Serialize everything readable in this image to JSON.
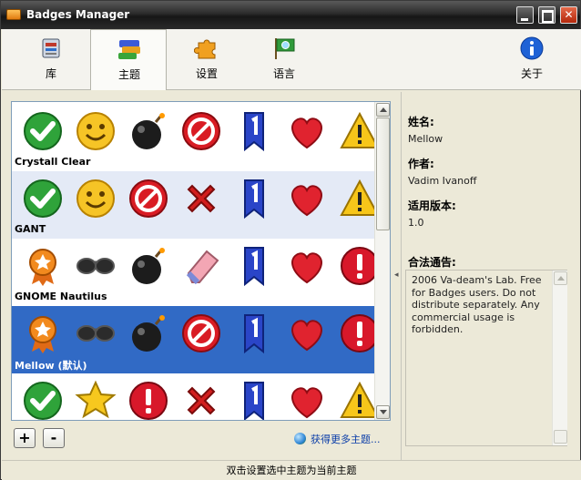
{
  "window": {
    "title": "Badges Manager",
    "controls": [
      "minimize",
      "maximize",
      "close"
    ]
  },
  "toolbar": {
    "items": [
      {
        "label": "库",
        "icon": "library-icon"
      },
      {
        "label": "主题",
        "icon": "themes-icon",
        "active": true
      },
      {
        "label": "设置",
        "icon": "settings-puzzle-icon"
      },
      {
        "label": "语言",
        "icon": "language-flag-icon"
      }
    ],
    "about": {
      "label": "关于",
      "icon": "info-icon"
    }
  },
  "themes": [
    {
      "name": "Crystall Clear",
      "style": "white",
      "badges": [
        "checkmark-icon",
        "smiley-icon",
        "bomb-icon",
        "stop-icon",
        "ribbon-one-icon",
        "heart-icon",
        "warning-icon"
      ]
    },
    {
      "name": "GANT",
      "style": "alt",
      "badges": [
        "checkmark-icon",
        "smiley-icon",
        "stop-icon",
        "cross-icon",
        "ribbon-one-icon",
        "heart-icon",
        "warning-icon"
      ]
    },
    {
      "name": "GNOME Nautilus",
      "style": "white",
      "badges": [
        "award-icon",
        "sunglasses-icon",
        "bomb-icon",
        "eraser-icon",
        "ribbon-one-icon",
        "heart-icon",
        "exclamation-icon"
      ]
    },
    {
      "name": "Mellow (默认)",
      "style": "selected",
      "badges": [
        "award-icon",
        "sunglasses-icon",
        "bomb-icon",
        "stop-icon",
        "ribbon-one-icon",
        "heart-icon",
        "exclamation-icon"
      ]
    },
    {
      "name": "",
      "style": "white",
      "badges": [
        "checkmark-icon",
        "star-icon",
        "exclamation-icon",
        "cross-icon",
        "ribbon-one-icon",
        "heart-icon",
        "warning-icon"
      ]
    }
  ],
  "actions": {
    "add": "+",
    "remove": "-",
    "more_themes": "获得更多主题..."
  },
  "info": {
    "name_label": "姓名:",
    "name_value": "Mellow",
    "author_label": "作者:",
    "author_value": "Vadim Ivanoff",
    "version_label": "适用版本:",
    "version_value": "1.0",
    "license_label": "合法通告:",
    "license_value": "2006 Va-deam's Lab. Free for Badges users. Do not distribute separately. Any commercial usage is forbidden."
  },
  "status": "双击设置选中主题为当前主题",
  "colors": {
    "selection": "#316ac5",
    "alt_row": "#e4eaf6",
    "link": "#0a3da8"
  }
}
